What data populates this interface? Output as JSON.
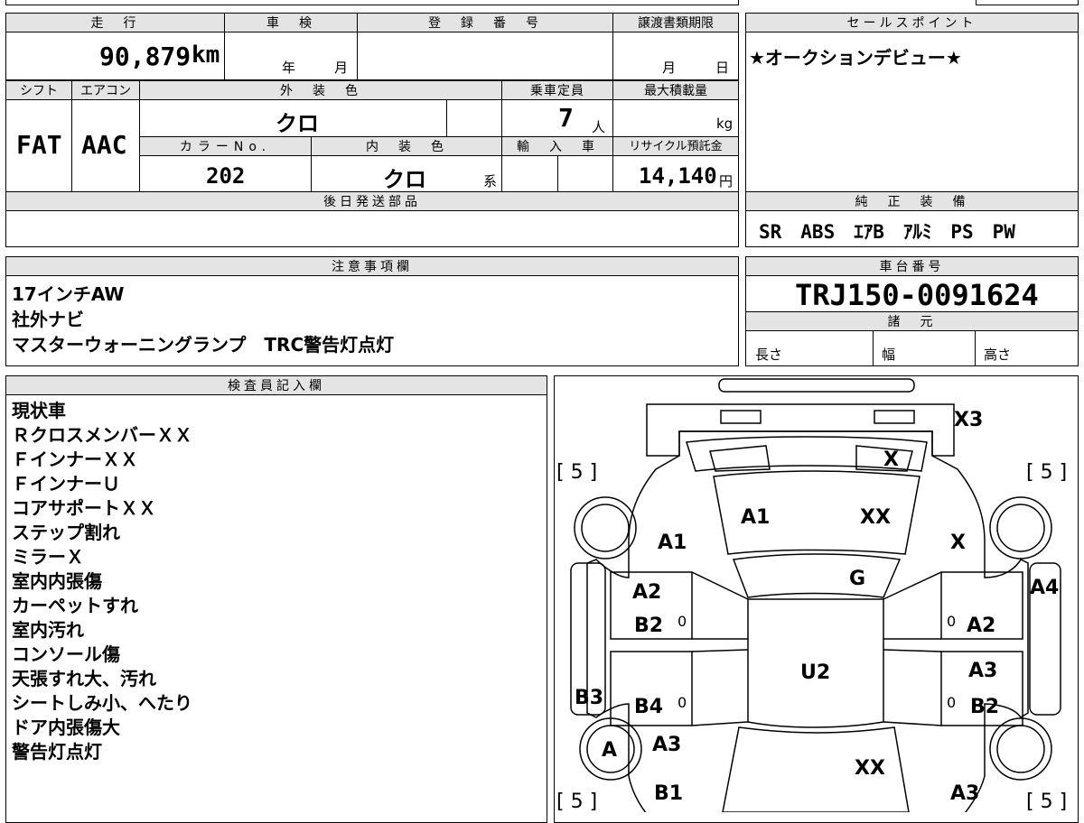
{
  "sheet": {
    "labels": {
      "mileage": "走　行",
      "inspection": "車　検",
      "registration": "登　録　番　号",
      "transfer_deadline": "譲渡書類期限",
      "sales_point": "セールスポイント",
      "shift": "シフト",
      "ac": "エアコン",
      "exterior_color": "外　装　色",
      "capacity": "乗車定員",
      "max_load": "最大積載量",
      "color_no": "カラーNo.",
      "interior_color": "内　装　色",
      "import": "輸　入　車",
      "recycle_fee": "リサイクル預託金",
      "later_parts": "後日発送部品",
      "genuine_equipment": "純　正　装　備",
      "notes": "注意事項欄",
      "chassis_no": "車台番号",
      "specs": "諸　元",
      "inspector_notes": "検査員記入欄"
    },
    "mileage": "90,879",
    "mileage_unit": "km",
    "inspection_year_unit": "年",
    "inspection_month_unit": "月",
    "deadline_month_unit": "月",
    "deadline_day_unit": "日",
    "sales_point": "★オークションデビュー★",
    "shift": "FAT",
    "ac": "AAC",
    "exterior_color": "クロ",
    "capacity": "7",
    "capacity_unit": "人",
    "max_load_unit": "kg",
    "color_no": "202",
    "interior_color": "クロ",
    "interior_color_suffix": "系",
    "recycle_fee": "14,140",
    "recycle_fee_unit": "円",
    "equipment": "SR　ABS　ｴｱB　ｱﾙﾐ　PS　PW",
    "chassis_no": "TRJ150-0091624",
    "spec_length": "長さ",
    "spec_width": "幅",
    "spec_height": "高さ",
    "notes": [
      "17インチAW",
      "社外ナビ",
      "マスターウォーニングランプ　TRC警告灯点灯"
    ],
    "inspector_notes": [
      "現状車",
      "ＲクロスメンバーＸＸ",
      "ＦインナーＸＸ",
      "ＦインナーＵ",
      "コアサポートＸＸ",
      "ステップ割れ",
      "ミラーＸ",
      "室内内張傷",
      "カーペットすれ",
      "室内汚れ",
      "コンソール傷",
      "天張すれ大、汚れ",
      "シートしみ小、へたり",
      "ドア内張傷大",
      "警告灯点灯"
    ]
  },
  "diagram": {
    "tires": {
      "front_left": "[ 5 ]",
      "front_right": "[ 5 ]",
      "rear_left": "[ 5 ]",
      "rear_right": "[ 5 ]"
    },
    "marks": {
      "rear_bumper": "X3",
      "rear_glass": "X",
      "roof_front": "A1",
      "roof_rear": "XX",
      "left_quarter": "A1",
      "right_quarter": "X",
      "roof": "G",
      "left_rear_door_a": "A2",
      "left_rear_door_b": "B2",
      "right_rear_door_a": "A2",
      "right_fender_edge": "A4",
      "center": "U2",
      "right_front_door_a": "A3",
      "right_front_door_b": "B2",
      "left_step": "B3",
      "left_front_door": "B4",
      "left_front_wheel": "A",
      "left_fender_a": "A3",
      "left_fender_b": "B1",
      "hood": "XX",
      "right_fender": "A3",
      "zero_1": "0",
      "zero_2": "0",
      "zero_3": "0",
      "zero_4": "0"
    }
  }
}
